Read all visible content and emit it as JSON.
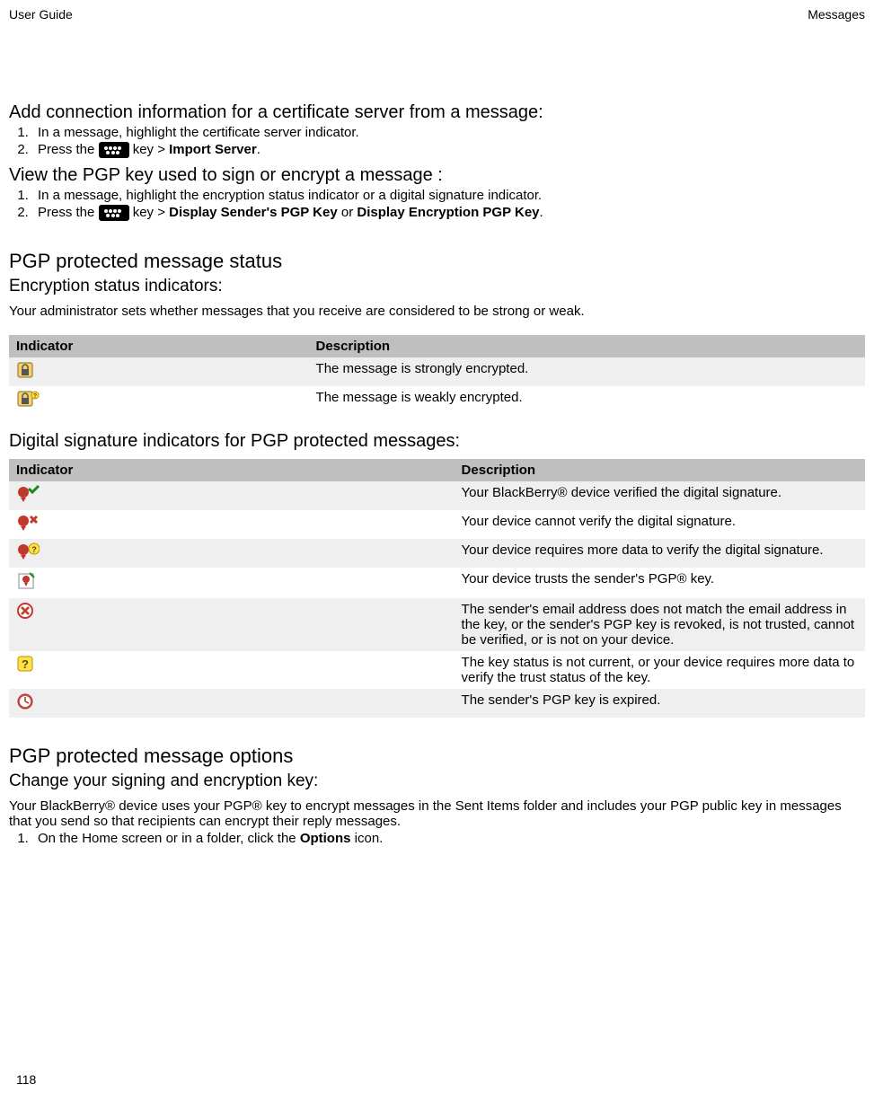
{
  "header": {
    "left": "User Guide",
    "right": "Messages"
  },
  "sec1": {
    "title": "Add connection information for a certificate server from a message:",
    "steps": [
      "In a message, highlight the certificate server indicator.",
      {
        "pre": "Press the ",
        "post": " key > ",
        "bold": "Import Server",
        "end": "."
      }
    ]
  },
  "sec2": {
    "title": "View the PGP key used to sign or encrypt a message :",
    "steps": [
      "In a message, highlight the encryption status indicator or a digital signature indicator.",
      {
        "pre": "Press the ",
        "post": " key > ",
        "bold1": "Display Sender's PGP Key",
        "mid": " or ",
        "bold2": "Display Encryption PGP Key",
        "end": "."
      }
    ]
  },
  "status": {
    "heading": "PGP protected message status",
    "sub": "Encryption status indicators:",
    "intro": "Your administrator sets whether messages that you receive are considered to be strong or weak.",
    "th1": "Indicator",
    "th2": "Description",
    "rows": [
      {
        "icon": "lock-strong-icon",
        "desc": "The message is strongly encrypted."
      },
      {
        "icon": "lock-weak-icon",
        "desc": "The message is weakly encrypted."
      }
    ]
  },
  "sig": {
    "heading": "Digital signature indicators for PGP protected messages:",
    "th1": "Indicator",
    "th2": "Description",
    "rows": [
      {
        "icon": "ribbon-check-icon",
        "desc": "Your BlackBerry® device verified the digital signature."
      },
      {
        "icon": "ribbon-x-icon",
        "desc": "Your device cannot verify the digital signature."
      },
      {
        "icon": "ribbon-question-icon",
        "desc": "Your device requires more data to verify the digital signature."
      },
      {
        "icon": "ribbon-trust-icon",
        "desc": "Your device trusts the sender's PGP® key."
      },
      {
        "icon": "circle-x-icon",
        "desc": "The sender's email address does not match the email address in the key, or the sender's PGP key is revoked, is not trusted, cannot be verified, or is not on your device."
      },
      {
        "icon": "yellow-question-icon",
        "desc": "The key status is not current, or your device requires more data to verify the trust status of the key."
      },
      {
        "icon": "clock-expired-icon",
        "desc": "The sender's PGP key is expired."
      }
    ]
  },
  "options": {
    "heading": "PGP protected message options",
    "sub": "Change your signing and encryption key:",
    "intro": "Your BlackBerry® device uses your PGP® key to encrypt messages in the Sent Items folder and includes your PGP public key in messages that you send so that recipients can encrypt their reply messages.",
    "step1_pre": "On the Home screen or in a folder, click the ",
    "step1_bold": "Options",
    "step1_post": " icon."
  },
  "page": "118"
}
